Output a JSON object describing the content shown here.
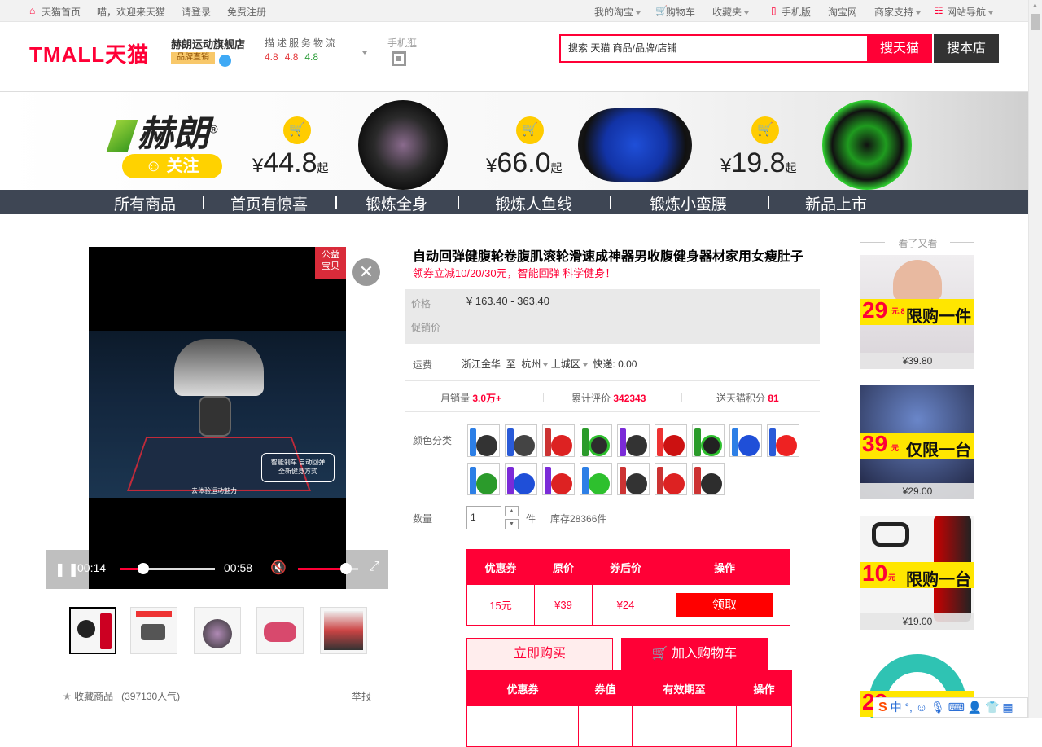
{
  "topbar": {
    "home": "天猫首页",
    "greeting": "喵，欢迎来天猫",
    "login": "请登录",
    "register": "免费注册",
    "my_taobao": "我的淘宝",
    "cart": "购物车",
    "favorites": "收藏夹",
    "mobile": "手机版",
    "taobao": "淘宝网",
    "merchant": "商家支持",
    "site_nav": "网站导航"
  },
  "header": {
    "logo": "TMALL天猫",
    "shop_name": "赫朗运动旗舰店",
    "brand_badge": "品牌直销",
    "dsr_title": "描述服务物流",
    "dsr_values": [
      "4.8",
      "4.8",
      "4.8"
    ],
    "mobile_label": "手机逛",
    "search_placeholder": "搜索 天猫 商品/品牌/店铺",
    "search_tmall": "搜天猫",
    "search_store": "搜本店"
  },
  "banner": {
    "brand": "赫朗",
    "follow": "关注",
    "prices": [
      {
        "currency": "¥",
        "amount": "44.8",
        "suffix": "起"
      },
      {
        "currency": "¥",
        "amount": "66.0",
        "suffix": "起"
      },
      {
        "currency": "¥",
        "amount": "19.8",
        "suffix": "起"
      }
    ]
  },
  "nav": [
    "所有商品",
    "首页有惊喜",
    "锻炼全身",
    "锻炼人鱼线",
    "锻炼小蛮腰",
    "新品上市"
  ],
  "video": {
    "badge": "公益宝贝",
    "caption_1": "智能刹车 自动回弹",
    "caption_2": "全新健身方式",
    "caption_3": "去体验运动魅力",
    "current_time": "00:14",
    "duration": "00:58",
    "progress": 0.24,
    "volume": 0.8
  },
  "gallery": {
    "favorite": "收藏商品",
    "popularity": "(397130人气)",
    "report": "举报"
  },
  "product": {
    "title": "自动回弹健腹轮卷腹肌滚轮滑速成神器男收腹健身器材家用女瘦肚子",
    "subtitle": "领券立减10/20/30元，智能回弹 科学健身！",
    "price_label": "价格",
    "original_price": "¥ 163.40 - 363.40",
    "promo_label": "促销价",
    "shipping_label": "运费",
    "shipping_from": "浙江金华",
    "shipping_to": "至",
    "shipping_city": "杭州",
    "shipping_district": "上城区",
    "shipping_cost": "快递: 0.00",
    "monthly_sales_label": "月销量",
    "monthly_sales": "3.0万+",
    "reviews_label": "累计评价",
    "reviews": "342343",
    "points_label": "送天猫积分",
    "points": "81",
    "color_label": "颜色分类",
    "qty_label": "数量",
    "qty_value": "1",
    "qty_unit": "件",
    "stock": "库存28366件"
  },
  "coupon_table": {
    "headers": [
      "优惠券",
      "原价",
      "券后价",
      "操作"
    ],
    "row": [
      "15元",
      "¥39",
      "¥24",
      "领取"
    ]
  },
  "actions": {
    "buy_now": "立即购买",
    "add_cart": "加入购物车"
  },
  "coupon_table_2": {
    "headers": [
      "优惠券",
      "券值",
      "有效期至",
      "操作"
    ]
  },
  "rail": {
    "title": "看了又看",
    "items": [
      {
        "promo_price": "29",
        "promo_decimal": "元.8",
        "promo_text": "限购一件",
        "price": "¥39.80"
      },
      {
        "promo_price": "39",
        "promo_decimal": "元",
        "promo_text": "仅限一台",
        "price": "¥29.00"
      },
      {
        "promo_price": "10",
        "promo_decimal": "元",
        "promo_text": "限购一台",
        "price": "¥19.00"
      },
      {
        "promo_price": "29",
        "promo_decimal": "",
        "promo_text": "",
        "price": ""
      }
    ]
  },
  "ime": {
    "logo": "S",
    "text": "中 °, ☺ 🎙 ⌨ 👤 👕 ▦"
  }
}
